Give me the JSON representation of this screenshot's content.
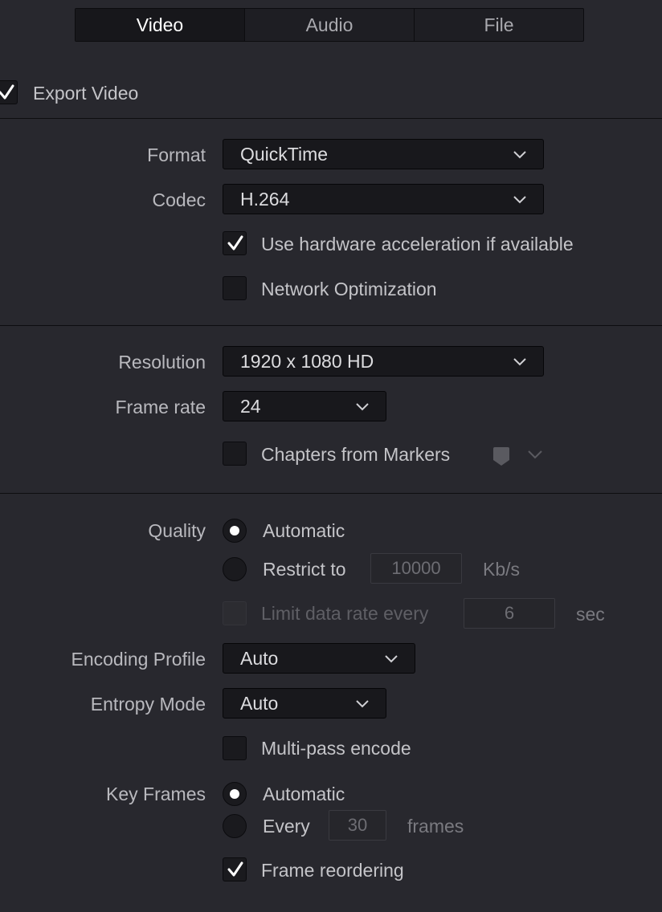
{
  "tabs": [
    {
      "label": "Video",
      "active": true
    },
    {
      "label": "Audio",
      "active": false
    },
    {
      "label": "File",
      "active": false
    }
  ],
  "export_video": {
    "label": "Export Video",
    "checked": true
  },
  "format": {
    "label": "Format",
    "value": "QuickTime"
  },
  "codec": {
    "label": "Codec",
    "value": "H.264"
  },
  "hw_accel": {
    "label": "Use hardware acceleration if available",
    "checked": true
  },
  "network_opt": {
    "label": "Network Optimization",
    "checked": false
  },
  "resolution": {
    "label": "Resolution",
    "value": "1920 x 1080 HD"
  },
  "frame_rate": {
    "label": "Frame rate",
    "value": "24"
  },
  "chapters": {
    "label": "Chapters from Markers",
    "checked": false
  },
  "quality": {
    "label": "Quality",
    "automatic_label": "Automatic",
    "restrict_label": "Restrict to",
    "restrict_value": "10000",
    "restrict_unit": "Kb/s",
    "selected": "Automatic"
  },
  "limit_data_rate": {
    "label": "Limit data rate every",
    "value": "6",
    "unit": "sec",
    "checked": false,
    "enabled": false
  },
  "encoding_profile": {
    "label": "Encoding Profile",
    "value": "Auto"
  },
  "entropy_mode": {
    "label": "Entropy Mode",
    "value": "Auto"
  },
  "multipass": {
    "label": "Multi-pass encode",
    "checked": false
  },
  "key_frames": {
    "label": "Key Frames",
    "automatic_label": "Automatic",
    "every_label": "Every",
    "every_value": "30",
    "every_unit": "frames",
    "selected": "Automatic"
  },
  "frame_reordering": {
    "label": "Frame reordering",
    "checked": true
  },
  "colors": {
    "background": "#28282e",
    "field": "#18181c",
    "active_tab": "#17171b"
  }
}
